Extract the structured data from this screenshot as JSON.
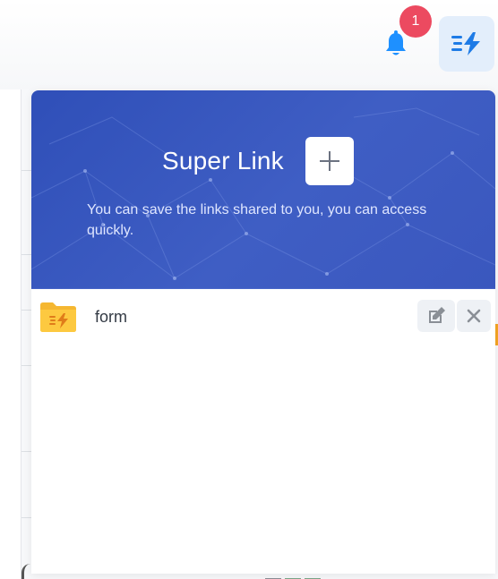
{
  "topbar": {
    "notification_count": "1"
  },
  "panel": {
    "title": "Super Link",
    "description": "You can save the links shared to you, you can access quickly.",
    "items": [
      {
        "label": "form"
      }
    ]
  },
  "colors": {
    "header_blue": "#3a57be",
    "badge_red": "#ec4a60",
    "bell_blue": "#1e90ff",
    "folder_orange": "#f5b731",
    "bolt_blue": "#1e7be6"
  },
  "icons": {
    "bell": "bell-icon",
    "superlink": "bolt-list-icon",
    "add": "plus-icon",
    "folder": "folder-bolt-icon",
    "edit": "edit-icon",
    "close": "close-icon"
  }
}
